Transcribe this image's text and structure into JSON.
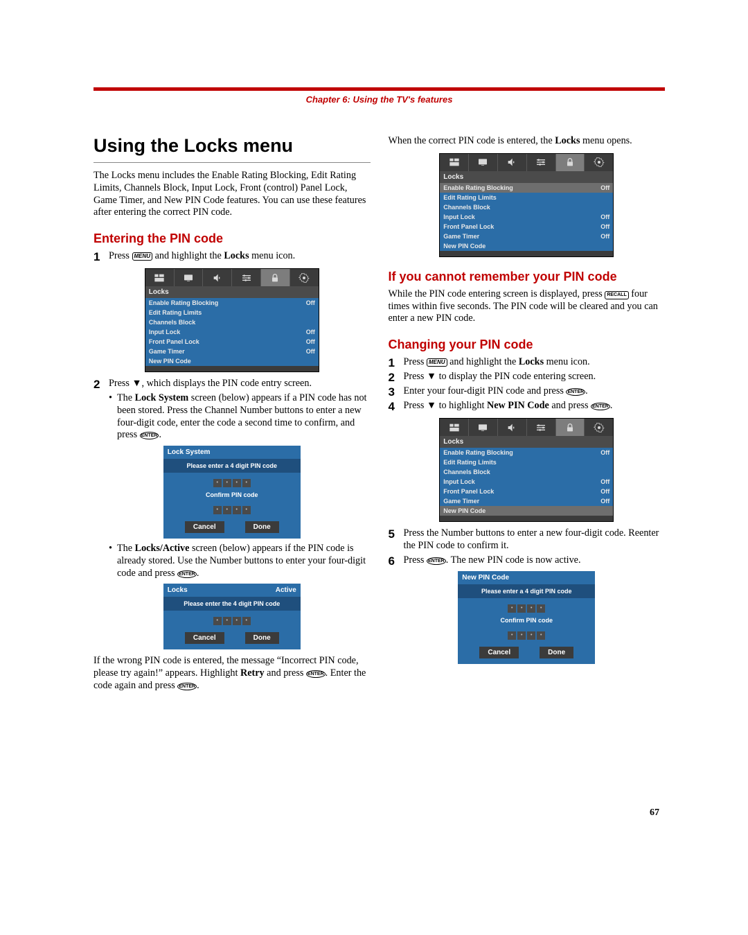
{
  "chapter": "Chapter 6: Using the TV's features",
  "title": "Using the Locks menu",
  "intro": "The Locks menu includes the Enable Rating Blocking, Edit Rating Limits, Channels Block, Input Lock, Front (control) Panel Lock, Game Timer, and New PIN Code features. You can use these features after entering the correct PIN code.",
  "h_enter": "Entering the PIN code",
  "s1": {
    "n": "1",
    "a": "Press ",
    "btn": "MENU",
    "b": " and highlight the ",
    "bold": "Locks",
    "c": " menu icon."
  },
  "s2": {
    "n": "2",
    "a": "Press ▼, which displays the PIN code entry screen."
  },
  "b1": {
    "a": "The ",
    "bold": "Lock System",
    "b": " screen (below) appears if a PIN code has not been stored. Press the Channel Number buttons to enter a new four-digit code, enter the code a second time to confirm, and press "
  },
  "b2": {
    "a": "The ",
    "bold": "Locks/Active",
    "b": " screen (below) appears if the PIN code is already stored. Use the Number buttons to enter your four-digit code and press "
  },
  "wrongpin": {
    "a": "If the wrong PIN code is entered, the message “Incorrect PIN code, please try again!” appears. Highlight ",
    "bold": "Retry",
    "b": " and press ",
    "c": ". Enter the code again and press "
  },
  "rightcol_opener": {
    "a": "When the correct PIN code is entered, the ",
    "bold": "Locks",
    "b": " menu opens."
  },
  "h_forgot": "If you cannot remember your PIN code",
  "forgot": {
    "a": "While the PIN code entering screen is displayed, press ",
    "btn": "RECALL",
    "b": " four times within five seconds. The PIN code will be cleared and you can enter a new PIN code."
  },
  "h_change": "Changing your PIN code",
  "c1": {
    "n": "1",
    "a": "Press ",
    "btn": "MENU",
    "b": " and highlight the ",
    "bold": "Locks",
    "c": " menu icon."
  },
  "c2": {
    "n": "2",
    "a": "Press ▼ to display the PIN code entering screen."
  },
  "c3": {
    "n": "3",
    "a": "Enter your four-digit PIN code and press "
  },
  "c4": {
    "n": "4",
    "a": "Press ▼ to highlight ",
    "bold": "New PIN Code",
    "b": " and press "
  },
  "c5": {
    "n": "5",
    "a": "Press the Number buttons to enter a new four-digit code. Reenter the PIN code to confirm it."
  },
  "c6": {
    "n": "6",
    "a": "Press ",
    "b": ". The new PIN code is now active."
  },
  "pagenum": "67",
  "osd": {
    "header": "Locks",
    "rows": [
      {
        "l": "Enable Rating Blocking",
        "v": "Off"
      },
      {
        "l": "Edit Rating Limits",
        "v": ""
      },
      {
        "l": "Channels Block",
        "v": ""
      },
      {
        "l": "Input Lock",
        "v": "Off"
      },
      {
        "l": "Front Panel Lock",
        "v": "Off"
      },
      {
        "l": "Game Timer",
        "v": "Off"
      },
      {
        "l": "New PIN Code",
        "v": ""
      }
    ]
  },
  "lockSystem": {
    "title": "Lock  System",
    "msg": "Please enter a 4 digit PIN code",
    "confirm": "Confirm PIN code",
    "cancel": "Cancel",
    "done": "Done"
  },
  "locksActive": {
    "title": "Locks",
    "active": "Active",
    "msg": "Please enter the 4 digit PIN code",
    "cancel": "Cancel",
    "done": "Done"
  },
  "newPin": {
    "title": "New PIN Code",
    "msg": "Please enter a 4 digit PIN code",
    "confirm": "Confirm PIN code",
    "cancel": "Cancel",
    "done": "Done"
  },
  "enter": "ENTER"
}
